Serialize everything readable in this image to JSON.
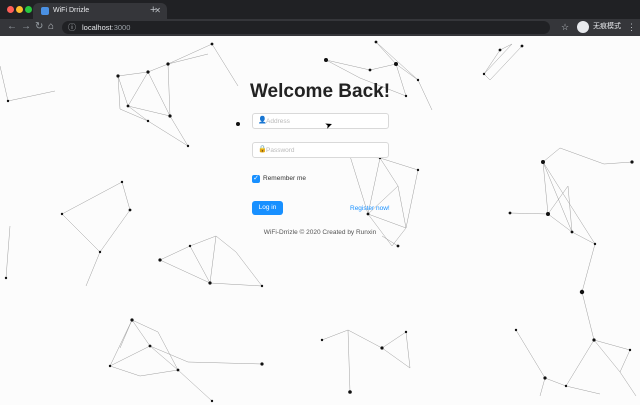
{
  "browser": {
    "tab_title": "WiFi Drrizle",
    "url_host": "localhost",
    "url_port": ":3000",
    "profile_label": "无痕模式"
  },
  "login": {
    "title": "Welcome Back!",
    "address_placeholder": "Address",
    "password_placeholder": "Password",
    "remember_label": "Remember me",
    "remember_checked": true,
    "register_link": "Register now!",
    "login_button": "Log in",
    "footer": "WiFi-Drrizle © 2020 Created by Runxin"
  },
  "colors": {
    "primary": "#1890ff",
    "chrome_dark": "#202124",
    "chrome_toolbar": "#35363a"
  }
}
